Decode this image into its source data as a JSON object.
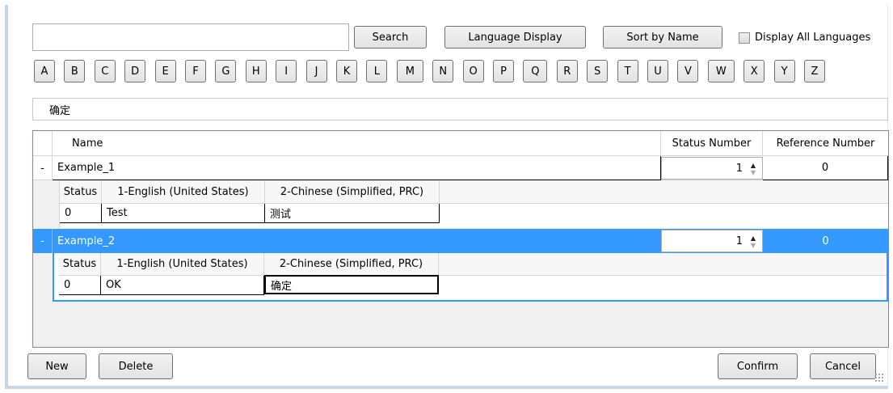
{
  "toolbar": {
    "search_value": "",
    "search_label": "Search",
    "language_display_label": "Language Display",
    "sort_label": "Sort by Name",
    "display_all_label": "Display All Languages",
    "display_all_checked": false
  },
  "letters": [
    "A",
    "B",
    "C",
    "D",
    "E",
    "F",
    "G",
    "H",
    "I",
    "J",
    "K",
    "L",
    "M",
    "N",
    "O",
    "P",
    "Q",
    "R",
    "S",
    "T",
    "U",
    "V",
    "W",
    "X",
    "Y",
    "Z"
  ],
  "text_field_value": "确定",
  "grid": {
    "columns": [
      "Name",
      "Status Number",
      "Reference Number"
    ],
    "sub_columns": [
      "Status",
      "1-English (United States)",
      "2-Chinese (Simplified, PRC)"
    ],
    "rows": [
      {
        "expander": "-",
        "name": "Example_1",
        "status_number": "1",
        "reference_number": "0",
        "selected": false,
        "details": [
          {
            "status": "0",
            "english": "Test",
            "chinese": "测试"
          }
        ]
      },
      {
        "expander": "-",
        "name": "Example_2",
        "status_number": "1",
        "reference_number": "0",
        "selected": true,
        "details": [
          {
            "status": "0",
            "english": "OK",
            "chinese": "确定"
          }
        ]
      }
    ]
  },
  "footer": {
    "new_label": "New",
    "delete_label": "Delete",
    "confirm_label": "Confirm",
    "cancel_label": "Cancel"
  },
  "colors": {
    "selection": "#3399ff",
    "window_border": "#c9d6e6"
  }
}
